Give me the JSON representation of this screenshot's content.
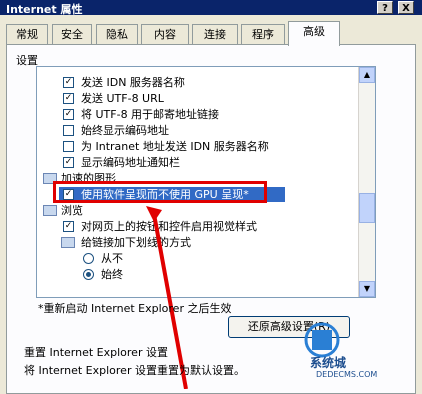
{
  "window": {
    "title": "Internet 属性",
    "help_btn": "?",
    "close_btn": "X"
  },
  "tabs": [
    {
      "label": "常规"
    },
    {
      "label": "安全"
    },
    {
      "label": "隐私"
    },
    {
      "label": "内容"
    },
    {
      "label": "连接"
    },
    {
      "label": "程序"
    },
    {
      "label": "高级",
      "active": true
    }
  ],
  "settings": {
    "group_label": "设置",
    "items": [
      {
        "label": "发送 IDN 服务器名称",
        "type": "checkbox",
        "checked": true
      },
      {
        "label": "发送 UTF-8 URL",
        "type": "checkbox",
        "checked": true
      },
      {
        "label": "将 UTF-8 用于邮寄地址链接",
        "type": "checkbox",
        "checked": true
      },
      {
        "label": "始终显示编码地址",
        "type": "checkbox",
        "checked": false
      },
      {
        "label": "为 Intranet 地址发送 IDN 服务器名称",
        "type": "checkbox",
        "checked": false
      },
      {
        "label": "显示编码地址通知栏",
        "type": "checkbox",
        "checked": true
      },
      {
        "label": "加速的图形",
        "type": "folder"
      },
      {
        "label": "使用软件呈现而不使用 GPU 呈现*",
        "type": "checkbox",
        "checked": true,
        "selected": true
      },
      {
        "label": "浏览",
        "type": "folder"
      },
      {
        "label": "对网页上的按钮和控件启用视觉样式",
        "type": "checkbox",
        "checked": true
      },
      {
        "label": "给链接加下划线的方式",
        "type": "folder"
      },
      {
        "label": "从不",
        "type": "radio",
        "checked": false
      },
      {
        "label": "始终",
        "type": "radio",
        "checked": true
      }
    ]
  },
  "restart_note": "*重新启动 Internet Explorer 之后生效",
  "restore_button": "还原高级设置(R)",
  "reset_section": {
    "label": "重置 Internet Explorer 设置",
    "description": "将 Internet Explorer 设置重置为默认设置。"
  },
  "watermark": {
    "line1": "系统城",
    "line2": "DEDECMS.COM",
    "site": "xitongcheng.com"
  },
  "colors": {
    "titlebar": "#0a246a",
    "selection": "#316ac5",
    "annotation": "#e00000"
  }
}
